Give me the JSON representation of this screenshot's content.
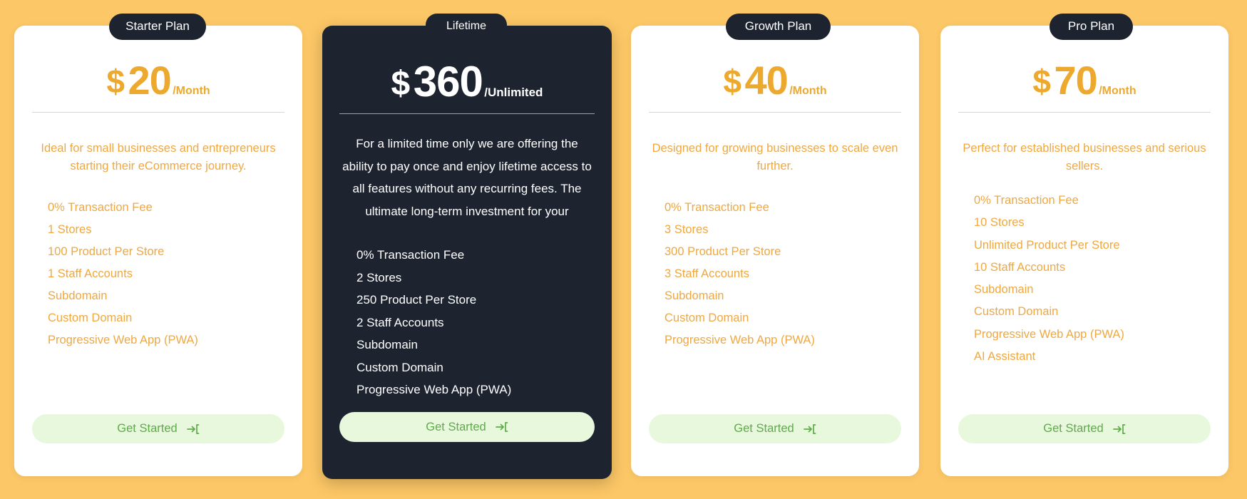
{
  "theme": {
    "page_background": "#fcc766",
    "accent": "#efa840",
    "price_color": "#eda92e",
    "featured_background": "#1e2330",
    "badge_background": "#1e2330",
    "cta_background": "#e7f8dd",
    "cta_text_color": "#5fab4a",
    "divider_color": "#c9dbe5"
  },
  "cta": {
    "label": "Get Started",
    "icon": "sign-in-arrow-icon"
  },
  "plans": [
    {
      "badge": "Starter Plan",
      "currency": "$",
      "amount": "20",
      "period": "/Month",
      "description": "Ideal for small businesses and entrepreneurs starting their eCommerce journey.",
      "features": [
        "0% Transaction Fee",
        "1 Stores",
        "100 Product Per Store",
        "1 Staff Accounts",
        "Subdomain",
        "Custom Domain",
        "Progressive Web App (PWA)"
      ],
      "featured": false
    },
    {
      "badge": "Lifetime",
      "currency": "$",
      "amount": "360",
      "period": "/Unlimited",
      "description": "For a limited time only we are offering the ability to pay once and enjoy lifetime access to all features without any recurring fees. The ultimate long-term investment for your",
      "features": [
        "0% Transaction Fee",
        "2 Stores",
        "250 Product Per Store",
        "2 Staff Accounts",
        "Subdomain",
        "Custom Domain",
        "Progressive Web App (PWA)"
      ],
      "featured": true
    },
    {
      "badge": "Growth Plan",
      "currency": "$",
      "amount": "40",
      "period": "/Month",
      "description": "Designed for growing businesses to scale even further.",
      "features": [
        "0% Transaction Fee",
        "3 Stores",
        "300 Product Per Store",
        "3 Staff Accounts",
        "Subdomain",
        "Custom Domain",
        "Progressive Web App (PWA)"
      ],
      "featured": false
    },
    {
      "badge": "Pro Plan",
      "currency": "$",
      "amount": "70",
      "period": "/Month",
      "description": "Perfect for established businesses and serious sellers.",
      "features": [
        "0% Transaction Fee",
        "10 Stores",
        "Unlimited Product Per Store",
        "10 Staff Accounts",
        "Subdomain",
        "Custom Domain",
        "Progressive Web App (PWA)",
        "AI Assistant"
      ],
      "featured": false
    }
  ]
}
